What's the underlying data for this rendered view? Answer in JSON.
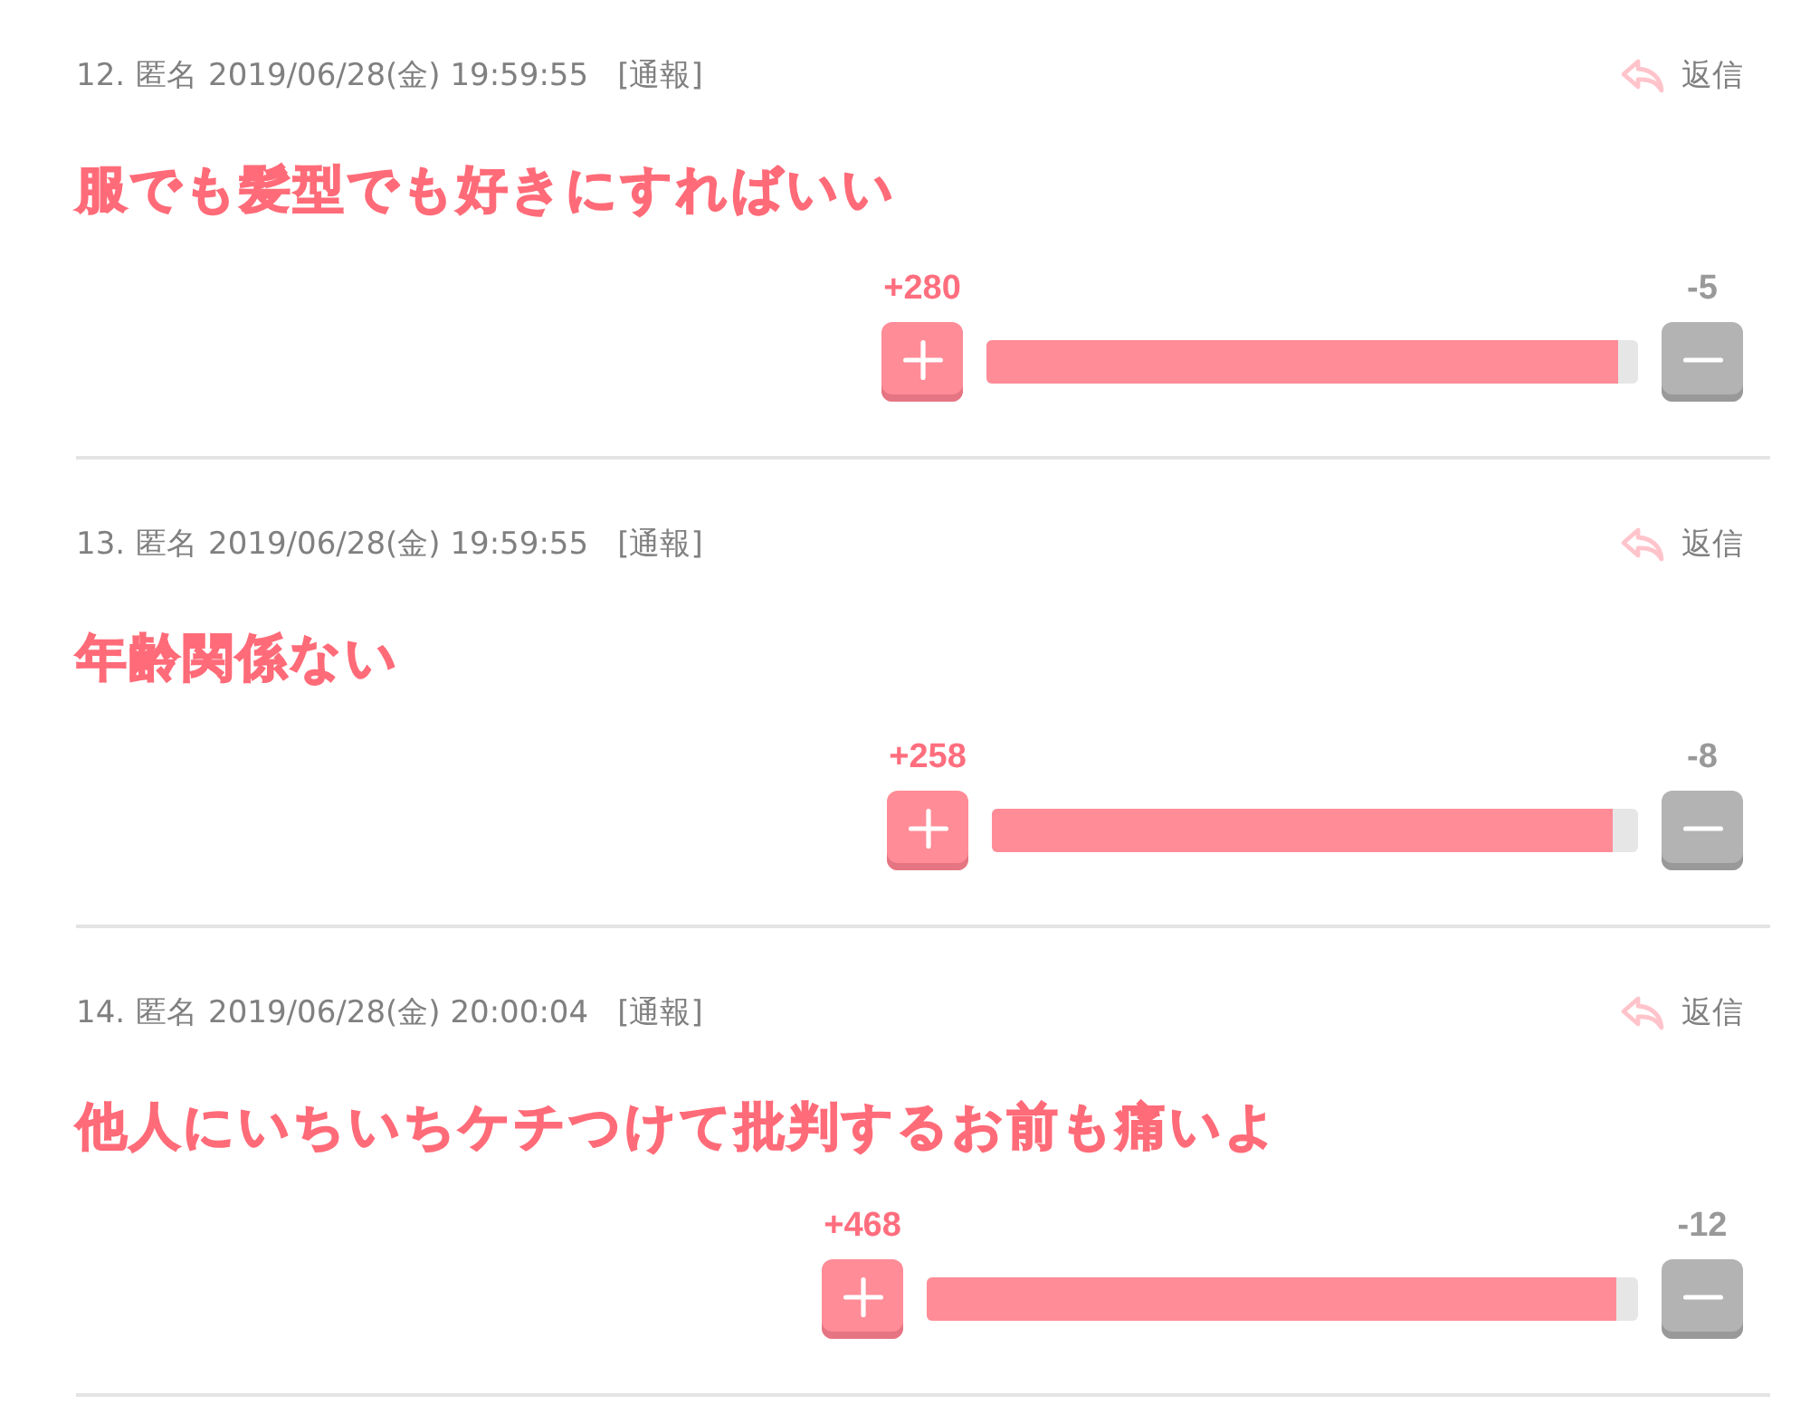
{
  "comments": [
    {
      "number": "12.",
      "name": "匿名",
      "date": "2019/06/28(金) 19:59:55",
      "report": "[通報]",
      "reply": "返信",
      "body": "服でも髪型でも好きにすればいい",
      "votes": {
        "plus": "+280",
        "minus": "-5",
        "level": 0.97
      }
    },
    {
      "number": "13.",
      "name": "匿名",
      "date": "2019/06/28(金) 19:59:55",
      "report": "[通報]",
      "reply": "返信",
      "body": "年齢関係ない",
      "votes": {
        "plus": "+258",
        "minus": "-8",
        "level": 0.96
      }
    },
    {
      "number": "14.",
      "name": "匿名",
      "date": "2019/06/28(金) 20:00:04",
      "report": "[通報]",
      "reply": "返信",
      "body": "他人にいちいちケチつけて批判するお前も痛いよ",
      "votes": {
        "plus": "+468",
        "minus": "-12",
        "level": 0.97
      }
    }
  ]
}
